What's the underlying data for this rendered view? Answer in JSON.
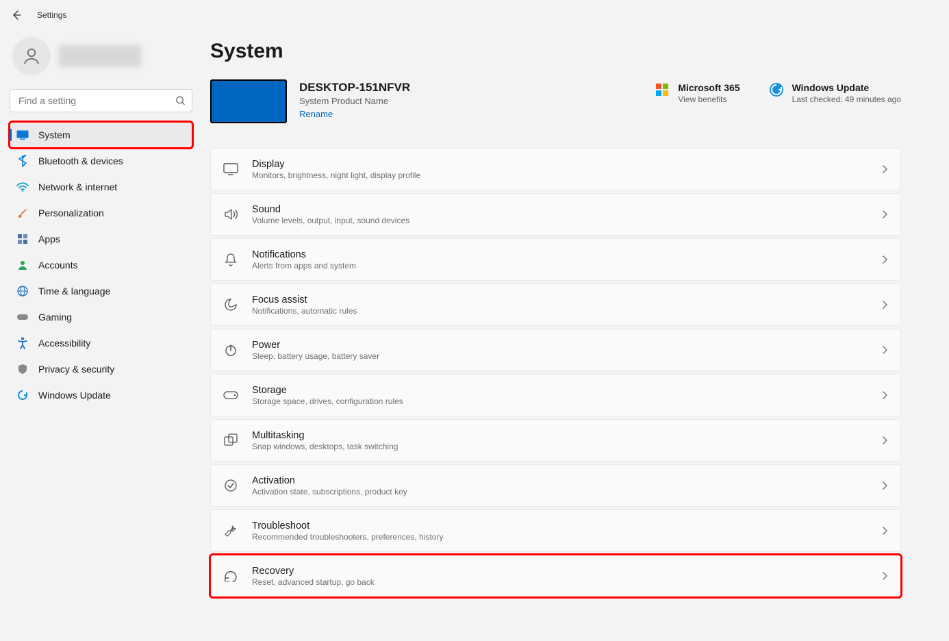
{
  "window": {
    "title": "Settings"
  },
  "search": {
    "placeholder": "Find a setting"
  },
  "nav": {
    "items": [
      {
        "label": "System",
        "icon": "system",
        "color": "#0a78d4",
        "active": true,
        "highlight": true
      },
      {
        "label": "Bluetooth & devices",
        "icon": "bluetooth",
        "color": "#0a78d4"
      },
      {
        "label": "Network & internet",
        "icon": "wifi",
        "color": "#0aa2ce"
      },
      {
        "label": "Personalization",
        "icon": "brush",
        "color": "#d77a3d"
      },
      {
        "label": "Apps",
        "icon": "apps",
        "color": "#4a6ea9"
      },
      {
        "label": "Accounts",
        "icon": "person",
        "color": "#2aa35a"
      },
      {
        "label": "Time & language",
        "icon": "globe",
        "color": "#2f7ac0"
      },
      {
        "label": "Gaming",
        "icon": "gamepad",
        "color": "#888888"
      },
      {
        "label": "Accessibility",
        "icon": "accessibility",
        "color": "#1a6fc0"
      },
      {
        "label": "Privacy & security",
        "icon": "shield",
        "color": "#888888"
      },
      {
        "label": "Windows Update",
        "icon": "update",
        "color": "#1a8fd8"
      }
    ]
  },
  "page": {
    "title": "System",
    "device": {
      "name": "DESKTOP-151NFVR",
      "product": "System Product Name",
      "rename_label": "Rename"
    },
    "status": [
      {
        "icon": "ms365",
        "title": "Microsoft 365",
        "sub": "View benefits"
      },
      {
        "icon": "update",
        "title": "Windows Update",
        "sub": "Last checked: 49 minutes ago"
      }
    ],
    "settings": [
      {
        "icon": "display",
        "title": "Display",
        "desc": "Monitors, brightness, night light, display profile"
      },
      {
        "icon": "sound",
        "title": "Sound",
        "desc": "Volume levels, output, input, sound devices"
      },
      {
        "icon": "notifications",
        "title": "Notifications",
        "desc": "Alerts from apps and system"
      },
      {
        "icon": "focus",
        "title": "Focus assist",
        "desc": "Notifications, automatic rules"
      },
      {
        "icon": "power",
        "title": "Power",
        "desc": "Sleep, battery usage, battery saver"
      },
      {
        "icon": "storage",
        "title": "Storage",
        "desc": "Storage space, drives, configuration rules"
      },
      {
        "icon": "multitask",
        "title": "Multitasking",
        "desc": "Snap windows, desktops, task switching"
      },
      {
        "icon": "activation",
        "title": "Activation",
        "desc": "Activation state, subscriptions, product key"
      },
      {
        "icon": "troubleshoot",
        "title": "Troubleshoot",
        "desc": "Recommended troubleshooters, preferences, history"
      },
      {
        "icon": "recovery",
        "title": "Recovery",
        "desc": "Reset, advanced startup, go back",
        "highlight": true
      }
    ]
  }
}
